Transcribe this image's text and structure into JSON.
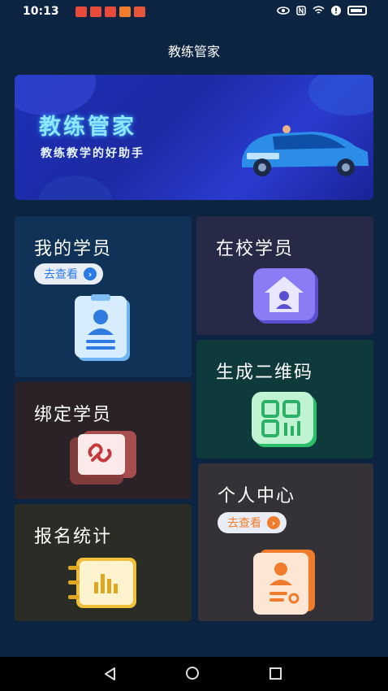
{
  "status_bar": {
    "time": "10:13"
  },
  "header": {
    "title": "教练管家"
  },
  "banner": {
    "title": "教练管家",
    "subtitle": "教练教学的好助手"
  },
  "cards": {
    "my_students": {
      "title": "我的学员",
      "pill": "去查看",
      "bg": "#113257"
    },
    "school_students": {
      "title": "在校学员",
      "bg": "#272a46"
    },
    "qr_code": {
      "title": "生成二维码",
      "bg": "#0f3a3b"
    },
    "bind_student": {
      "title": "绑定学员",
      "bg": "#2a2226"
    },
    "personal_center": {
      "title": "个人中心",
      "pill": "去查看",
      "bg": "#343236"
    },
    "enrollment_stats": {
      "title": "报名统计",
      "bg": "#2a2c26"
    }
  },
  "colors": {
    "accent_blue": "#2a7ae6",
    "accent_orange": "#ef7b2c"
  }
}
